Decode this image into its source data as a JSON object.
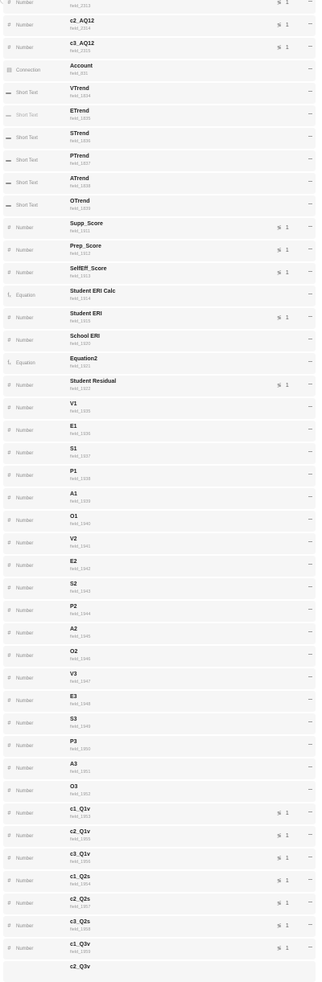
{
  "rows": [
    {
      "type": "Number",
      "icon": "hash-icon",
      "name": "",
      "id": "field_2313",
      "count": "1"
    },
    {
      "type": "Number",
      "icon": "hash-icon",
      "name": "c2_AQ12",
      "id": "field_2314",
      "count": "1"
    },
    {
      "type": "Number",
      "icon": "hash-icon",
      "name": "c3_AQ12",
      "id": "field_2315",
      "count": "1"
    },
    {
      "type": "Connection",
      "icon": "connection-icon",
      "name": "Account",
      "id": "field_831",
      "count": ""
    },
    {
      "type": "Short Text",
      "icon": "short-text-icon",
      "name": "VTrend",
      "id": "field_1834",
      "count": ""
    },
    {
      "type": "Short Text",
      "icon": "short-text-icon",
      "name": "ETrend",
      "id": "field_1835",
      "count": "",
      "muted": true
    },
    {
      "type": "Short Text",
      "icon": "short-text-icon",
      "name": "STrend",
      "id": "field_1836",
      "count": ""
    },
    {
      "type": "Short Text",
      "icon": "short-text-icon",
      "name": "PTrend",
      "id": "field_1837",
      "count": ""
    },
    {
      "type": "Short Text",
      "icon": "short-text-icon",
      "name": "ATrend",
      "id": "field_1838",
      "count": ""
    },
    {
      "type": "Short Text",
      "icon": "short-text-icon",
      "name": "OTrend",
      "id": "field_1839",
      "count": ""
    },
    {
      "type": "Number",
      "icon": "hash-icon",
      "name": "Supp_Score",
      "id": "field_1911",
      "count": "1"
    },
    {
      "type": "Number",
      "icon": "hash-icon",
      "name": "Prep_Score",
      "id": "field_1912",
      "count": "1"
    },
    {
      "type": "Number",
      "icon": "hash-icon",
      "name": "SelfEff_Score",
      "id": "field_1913",
      "count": "1"
    },
    {
      "type": "Equation",
      "icon": "equation-icon",
      "name": "Student ERI Calc",
      "id": "field_1914",
      "count": ""
    },
    {
      "type": "Number",
      "icon": "hash-icon",
      "name": "Student ERI",
      "id": "field_1915",
      "count": "1"
    },
    {
      "type": "Number",
      "icon": "hash-icon",
      "name": "School ERI",
      "id": "field_1920",
      "count": ""
    },
    {
      "type": "Equation",
      "icon": "equation-icon",
      "name": "Equation2",
      "id": "field_1921",
      "count": ""
    },
    {
      "type": "Number",
      "icon": "hash-icon",
      "name": "Student Residual",
      "id": "field_1922",
      "count": "1"
    },
    {
      "type": "Number",
      "icon": "hash-icon",
      "name": "V1",
      "id": "field_1935",
      "count": ""
    },
    {
      "type": "Number",
      "icon": "hash-icon",
      "name": "E1",
      "id": "field_1936",
      "count": ""
    },
    {
      "type": "Number",
      "icon": "hash-icon",
      "name": "S1",
      "id": "field_1937",
      "count": ""
    },
    {
      "type": "Number",
      "icon": "hash-icon",
      "name": "P1",
      "id": "field_1938",
      "count": ""
    },
    {
      "type": "Number",
      "icon": "hash-icon",
      "name": "A1",
      "id": "field_1939",
      "count": ""
    },
    {
      "type": "Number",
      "icon": "hash-icon",
      "name": "O1",
      "id": "field_1940",
      "count": ""
    },
    {
      "type": "Number",
      "icon": "hash-icon",
      "name": "V2",
      "id": "field_1941",
      "count": ""
    },
    {
      "type": "Number",
      "icon": "hash-icon",
      "name": "E2",
      "id": "field_1942",
      "count": ""
    },
    {
      "type": "Number",
      "icon": "hash-icon",
      "name": "S2",
      "id": "field_1943",
      "count": ""
    },
    {
      "type": "Number",
      "icon": "hash-icon",
      "name": "P2",
      "id": "field_1944",
      "count": ""
    },
    {
      "type": "Number",
      "icon": "hash-icon",
      "name": "A2",
      "id": "field_1945",
      "count": ""
    },
    {
      "type": "Number",
      "icon": "hash-icon",
      "name": "O2",
      "id": "field_1946",
      "count": ""
    },
    {
      "type": "Number",
      "icon": "hash-icon",
      "name": "V3",
      "id": "field_1947",
      "count": ""
    },
    {
      "type": "Number",
      "icon": "hash-icon",
      "name": "E3",
      "id": "field_1948",
      "count": ""
    },
    {
      "type": "Number",
      "icon": "hash-icon",
      "name": "S3",
      "id": "field_1949",
      "count": ""
    },
    {
      "type": "Number",
      "icon": "hash-icon",
      "name": "P3",
      "id": "field_1950",
      "count": ""
    },
    {
      "type": "Number",
      "icon": "hash-icon",
      "name": "A3",
      "id": "field_1951",
      "count": ""
    },
    {
      "type": "Number",
      "icon": "hash-icon",
      "name": "O3",
      "id": "field_1952",
      "count": ""
    },
    {
      "type": "Number",
      "icon": "hash-icon",
      "name": "c1_Q1v",
      "id": "field_1953",
      "count": "1"
    },
    {
      "type": "Number",
      "icon": "hash-icon",
      "name": "c2_Q1v",
      "id": "field_1955",
      "count": "1"
    },
    {
      "type": "Number",
      "icon": "hash-icon",
      "name": "c3_Q1v",
      "id": "field_1956",
      "count": "1"
    },
    {
      "type": "Number",
      "icon": "hash-icon",
      "name": "c1_Q2s",
      "id": "field_1954",
      "count": "1"
    },
    {
      "type": "Number",
      "icon": "hash-icon",
      "name": "c2_Q2s",
      "id": "field_1957",
      "count": "1"
    },
    {
      "type": "Number",
      "icon": "hash-icon",
      "name": "c3_Q2s",
      "id": "field_1958",
      "count": "1"
    },
    {
      "type": "Number",
      "icon": "hash-icon",
      "name": "c1_Q3v",
      "id": "field_1959",
      "count": "1"
    },
    {
      "type": "",
      "icon": "",
      "name": "c2_Q3v",
      "id": "",
      "count": ""
    }
  ]
}
